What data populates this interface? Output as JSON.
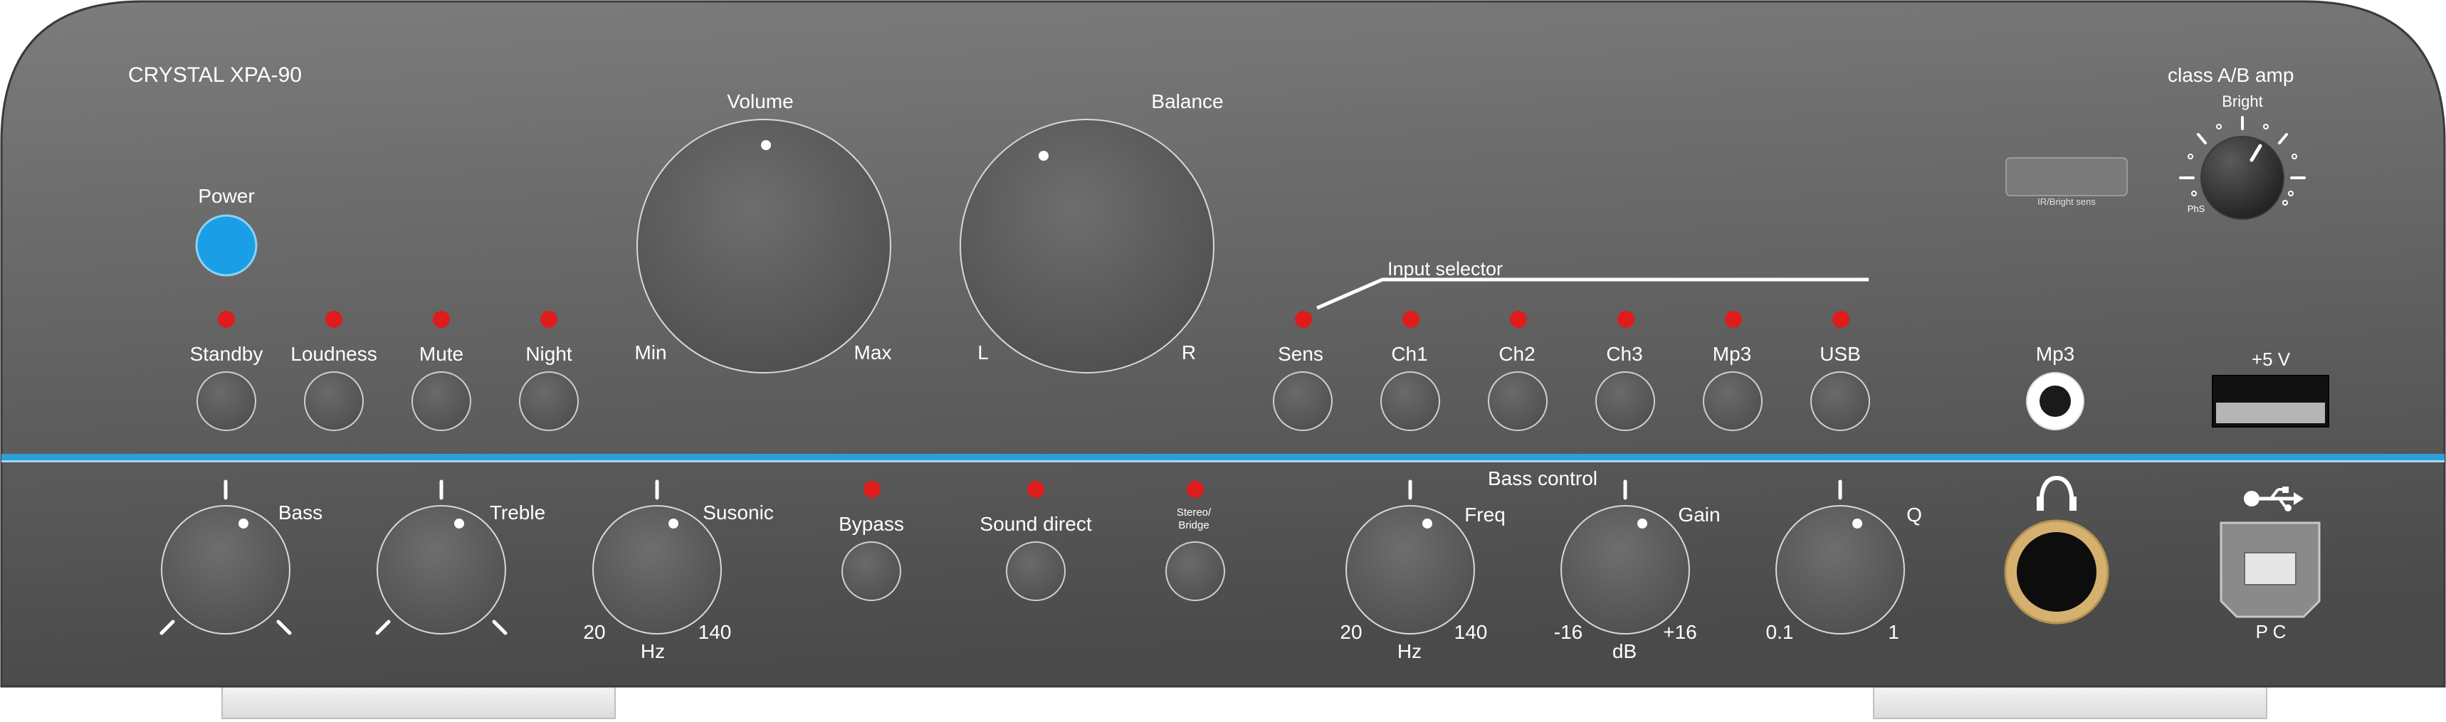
{
  "brand": {
    "model": "CRYSTAL XPA-90",
    "class_label": "class A/B amp"
  },
  "power": {
    "label": "Power",
    "color": "#1a9fe6"
  },
  "colors": {
    "led": "#e01b1b",
    "accent_line": "#2aa0d8",
    "panel_top": "#7a7a7a",
    "panel_bottom": "#4a4a4a"
  },
  "buttons": {
    "standby": "Standby",
    "loudness": "Loudness",
    "mute": "Mute",
    "night": "Night"
  },
  "knobs": {
    "volume": {
      "label": "Volume",
      "min": "Min",
      "max": "Max"
    },
    "balance": {
      "label": "Balance",
      "left": "L",
      "right": "R"
    }
  },
  "input_selector": {
    "title": "Input selector",
    "items": [
      "Sens",
      "Ch1",
      "Ch2",
      "Ch3",
      "Mp3",
      "USB"
    ]
  },
  "ir_sensor": {
    "label": "IR/Bright sens"
  },
  "bright": {
    "label": "Bright",
    "sub": "PhS"
  },
  "mp3_jack": {
    "label": "Mp3"
  },
  "usb_power": {
    "label": "+5 V"
  },
  "tone": {
    "bass": {
      "label": "Bass"
    },
    "treble": {
      "label": "Treble"
    },
    "susonic": {
      "label": "Susonic",
      "min": "20",
      "unit": "Hz",
      "max": "140"
    }
  },
  "switches": {
    "bypass": "Bypass",
    "sound_direct": "Sound direct",
    "stereo_bridge_1": "Stereo/",
    "stereo_bridge_2": "Bridge"
  },
  "bass_control": {
    "title": "Bass control",
    "freq": {
      "label": "Freq",
      "min": "20",
      "unit": "Hz",
      "max": "140"
    },
    "gain": {
      "label": "Gain",
      "min": "-16",
      "unit": "dB",
      "max": "+16"
    },
    "q": {
      "label": "Q",
      "min": "0.1",
      "max": "1"
    }
  },
  "pc_port": {
    "label": "P C",
    "icon": "usb-icon"
  },
  "headphone": {
    "icon": "headphones-icon"
  }
}
